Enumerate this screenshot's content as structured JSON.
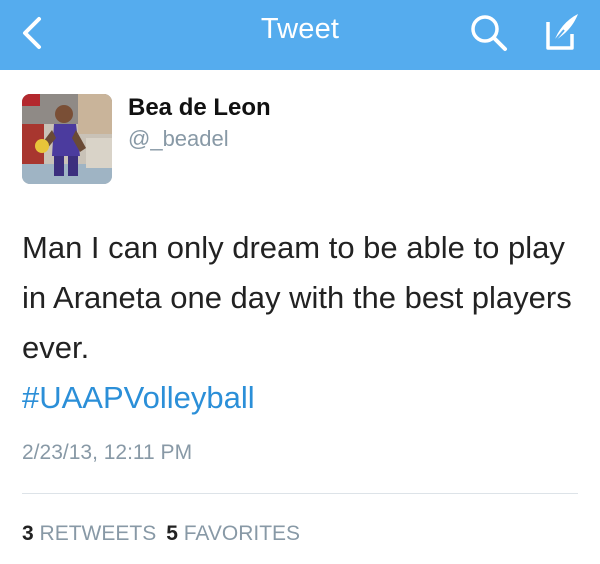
{
  "navbar": {
    "title": "Tweet",
    "bg_color": "#55acee",
    "back_icon": "chevron-left-icon",
    "search_icon": "search-icon",
    "compose_icon": "compose-icon"
  },
  "author": {
    "name": "Bea de Leon",
    "handle": "@_beadel",
    "avatar_icon": "avatar"
  },
  "tweet": {
    "text": "Man I can only dream to be able to play in Araneta one day with the best players ever.",
    "hashtag": "#UAAPVolleyball",
    "hashtag_color": "#2b8fd8",
    "timestamp": "2/23/13, 12:11 PM"
  },
  "stats": {
    "retweets_count": "3",
    "retweets_label": "RETWEETS",
    "favorites_count": "5",
    "favorites_label": "FAVORITES"
  }
}
